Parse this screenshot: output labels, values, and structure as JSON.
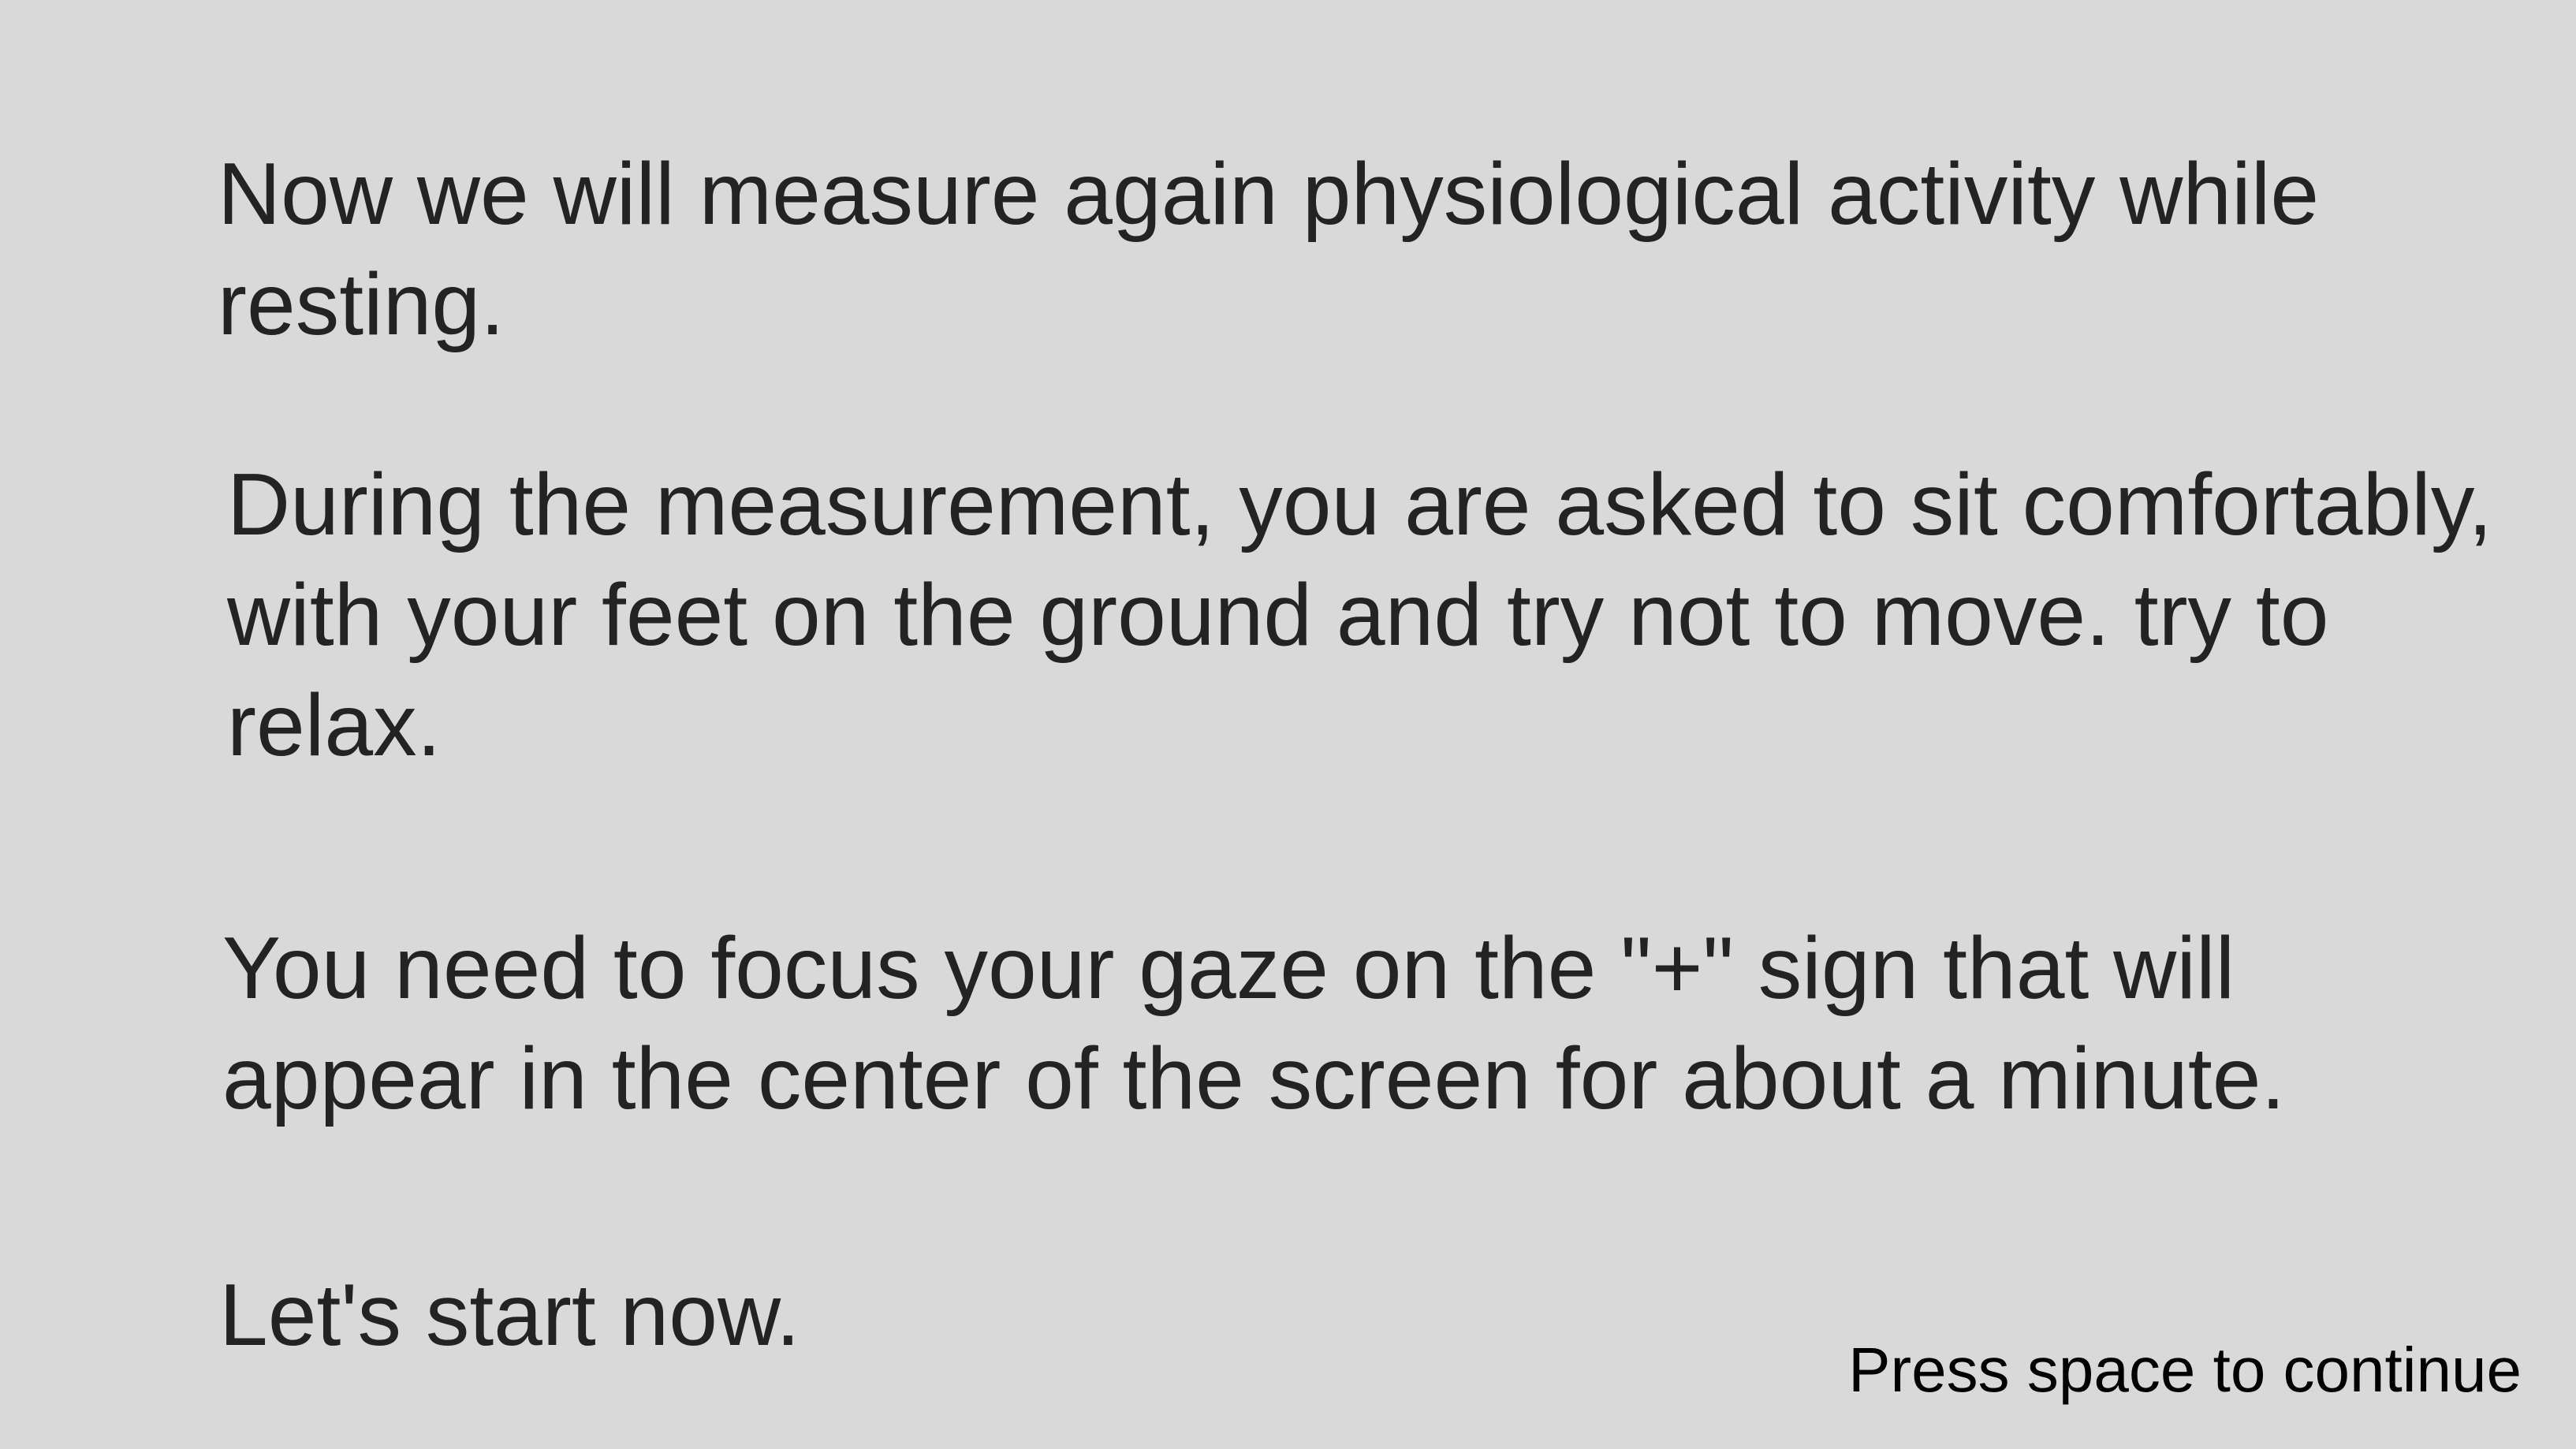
{
  "instructions": {
    "paragraph_1": [
      "Now we will measure again physiological activity while",
      "resting."
    ],
    "paragraph_2": [
      "During the measurement, you are asked to sit comfortably,",
      "with your feet on the ground and try not to move. try to",
      "relax."
    ],
    "paragraph_3": [
      "You need to focus your gaze on the \"+\" sign that will",
      "appear in the center of the screen for about a minute."
    ],
    "paragraph_4": [
      "Let's start now."
    ]
  },
  "footer": {
    "continue_prompt": "Press space to continue"
  },
  "colors": {
    "background": "#d9d9d9",
    "text": "#232323",
    "prompt_text": "#000000"
  }
}
